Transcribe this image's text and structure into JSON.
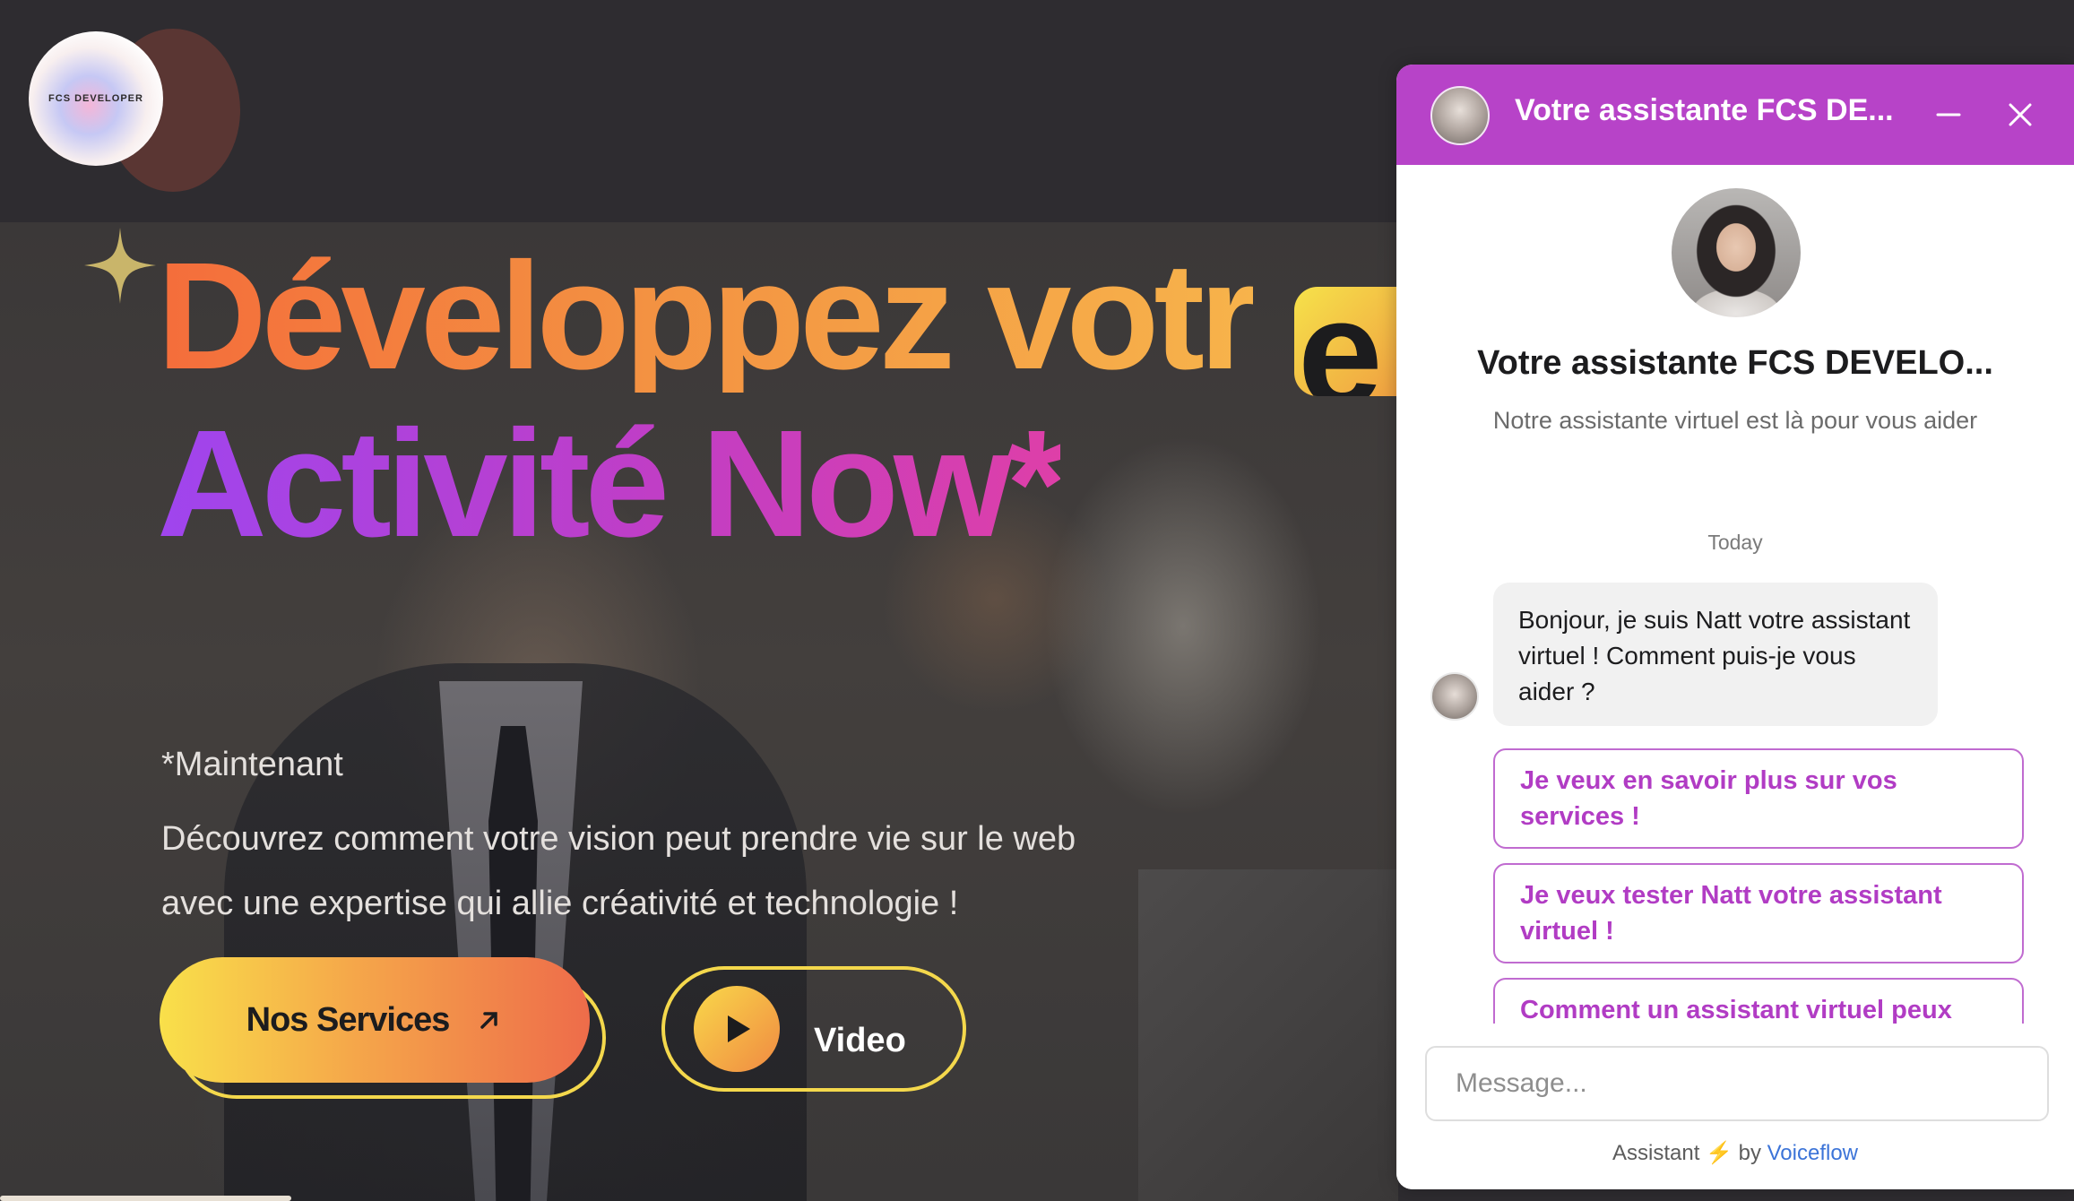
{
  "logo": {
    "text": "FCS DEVELOPER"
  },
  "hero": {
    "headline_line1": "Développez votr",
    "headline_highlight": "e",
    "headline_line2": "Activité Now*",
    "tagline": "*Maintenant",
    "description": "Découvrez comment votre vision peut prendre vie sur le web avec une expertise qui allie créativité et technologie !",
    "services_button": "Nos Services",
    "video_button": "Video"
  },
  "chat": {
    "header_title": "Votre assistante FCS DE...",
    "assistant_name": "Votre assistante FCS DEVELO...",
    "assistant_description": "Notre assistante virtuel est là pour vous aider",
    "date_separator": "Today",
    "messages": [
      {
        "text": "Bonjour, je suis Natt votre assistant virtuel ! Comment puis-je vous aider ?"
      }
    ],
    "choices": [
      {
        "label": "Je veux en savoir plus sur vos services !"
      },
      {
        "label": "Je veux tester Natt votre assistant virtuel !"
      },
      {
        "label": "Comment un assistant virtuel peux"
      }
    ],
    "input_placeholder": "Message...",
    "footer_prefix": "Assistant",
    "footer_by": "by",
    "footer_brand": "Voiceflow"
  },
  "colors": {
    "chat_header": "#b743c8",
    "choice_text": "#b13cc4",
    "headline_orange": "#f46d3b",
    "headline_purple": "#9f45ee",
    "button_yellow": "#f9e04a",
    "link_blue": "#3c74d8"
  },
  "icons": {
    "sparkle": "sparkle-icon",
    "arrow": "arrow-up-right-icon",
    "play": "play-icon",
    "minimize": "minimize-icon",
    "close": "close-icon",
    "bolt": "lightning-icon"
  }
}
